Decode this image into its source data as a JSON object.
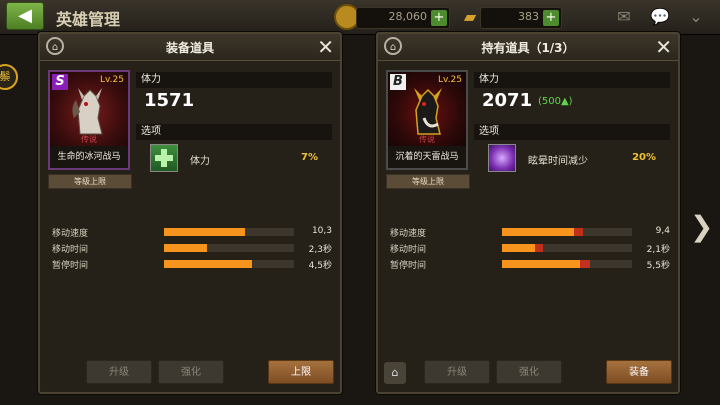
{
  "header": {
    "back_icon": "back-arrow-icon",
    "title": "英雄管理",
    "gold": "28,060",
    "gems": "383",
    "plus": "+"
  },
  "side_badge": "鬃",
  "left_panel": {
    "title": "装备道具",
    "close": "✕",
    "lock": "🔒",
    "card": {
      "grade": "S",
      "level": "Lv.25",
      "tag": "传说",
      "name": "生命的冰河战马"
    },
    "level_cap": "等级上限",
    "stat_label": "体力",
    "stat_value": "1571",
    "option_label": "选项",
    "option": {
      "icon": "green-cross-icon",
      "name": "体力",
      "value": "7%"
    },
    "bars": [
      {
        "label": "移动速度",
        "value": "10,3",
        "fill": 0.62
      },
      {
        "label": "移动时间",
        "value": "2,3秒",
        "fill": 0.33
      },
      {
        "label": "暂停时间",
        "value": "4,5秒",
        "fill": 0.68
      }
    ],
    "buttons": {
      "upgrade": "升级",
      "enhance": "强化",
      "action": "上限"
    }
  },
  "right_panel": {
    "title": "持有道具（1/3）",
    "close": "✕",
    "lock": "🔒",
    "card": {
      "grade": "B",
      "level": "Lv.25",
      "tag": "传说",
      "name": "沉着的天雷战马"
    },
    "level_cap": "等级上限",
    "stat_label": "体力",
    "stat_value": "2071",
    "stat_bonus": "(500▲)",
    "option_label": "选项",
    "option": {
      "icon": "purple-burst-icon",
      "name": "眩晕时间减少",
      "value": "20%"
    },
    "bars": [
      {
        "label": "移动速度",
        "value": "9,4",
        "fill": 0.55,
        "diff": 0.07
      },
      {
        "label": "移动时间",
        "value": "2,1秒",
        "fill": 0.25,
        "diff": 0.06
      },
      {
        "label": "暂停时间",
        "value": "5,5秒",
        "fill": 0.6,
        "diff": 0.08
      }
    ],
    "buttons": {
      "upgrade": "升级",
      "enhance": "强化",
      "action": "装备"
    }
  },
  "colors": {
    "bar_fill": "#f7941e",
    "bar_diff": "#c0301c",
    "accent_gold": "#f1c236",
    "bonus_green": "#5fd44a"
  }
}
